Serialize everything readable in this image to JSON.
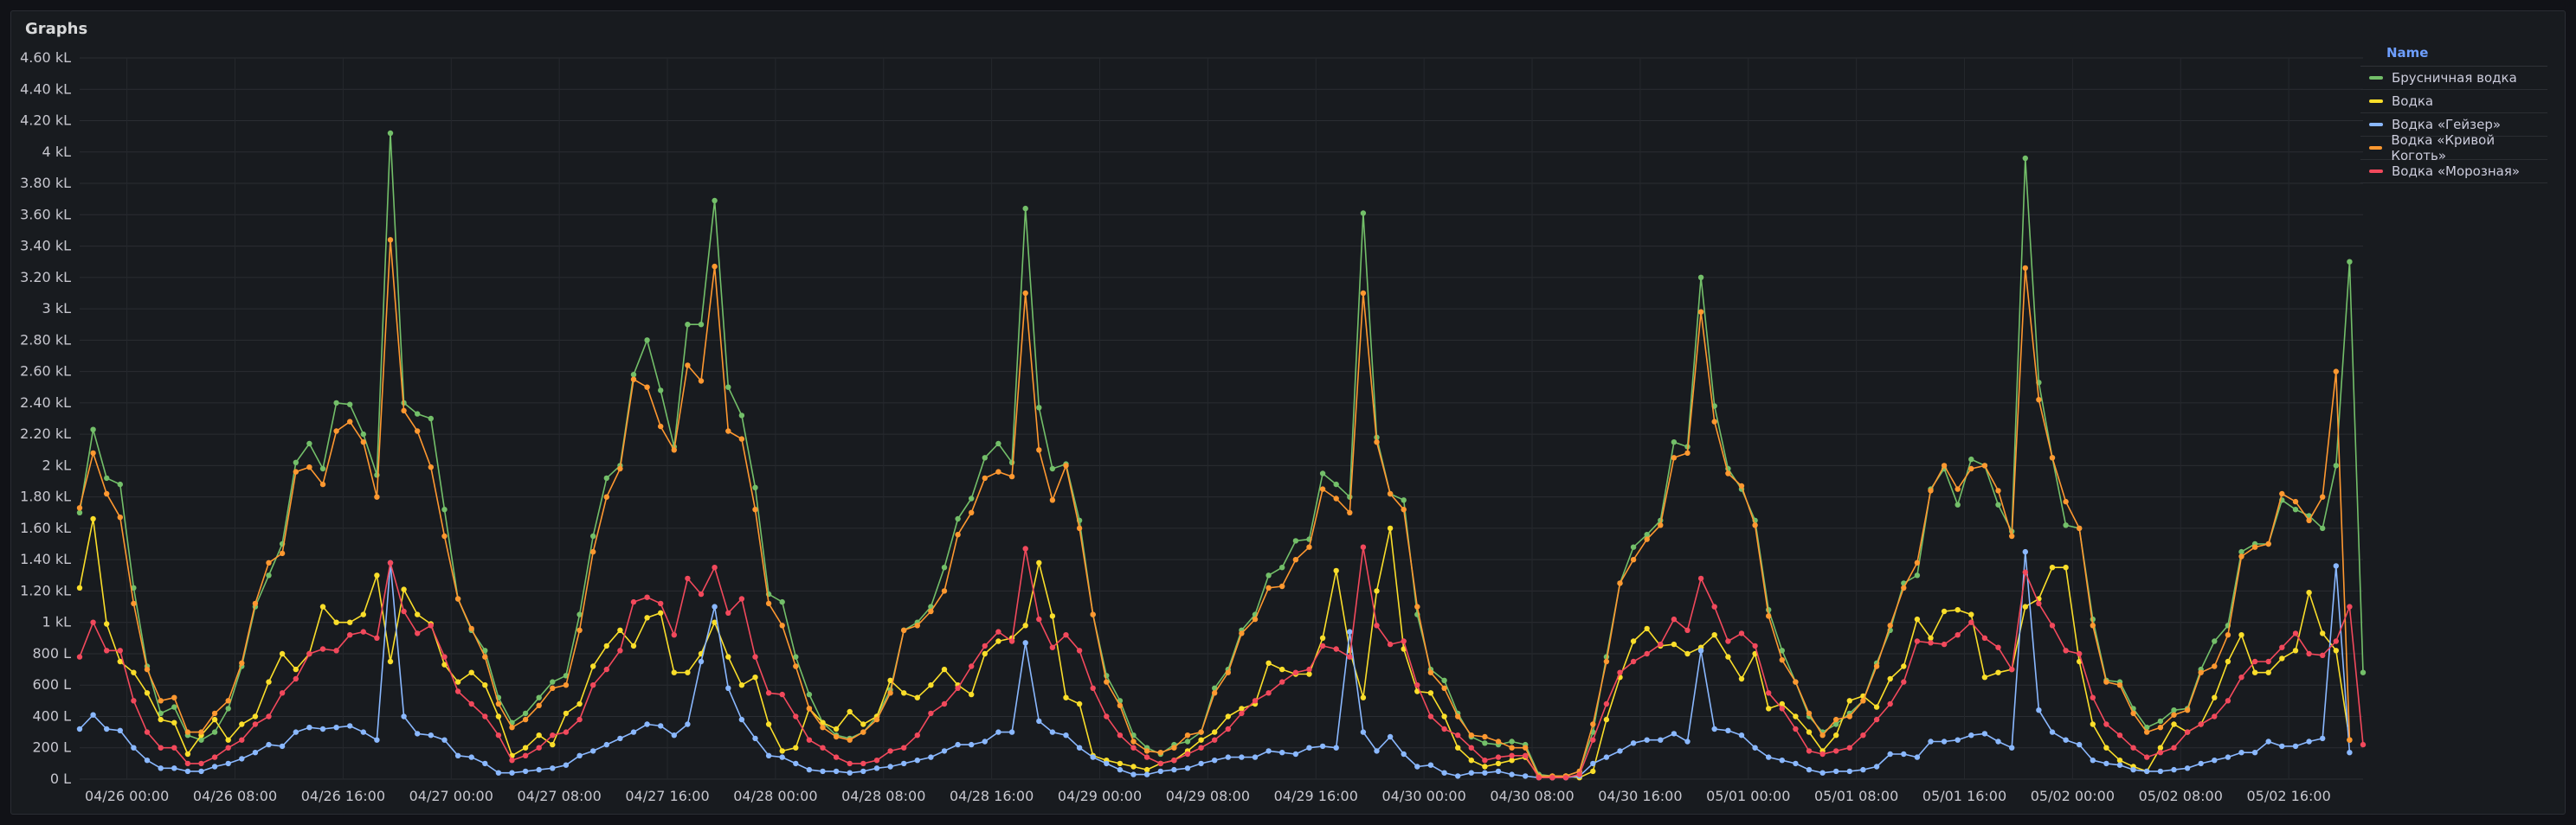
{
  "panel": {
    "title": "Graphs"
  },
  "legend": {
    "header": "Name"
  },
  "colors": {
    "s0": "#73bf69",
    "s1": "#fade2a",
    "s2": "#8ab8ff",
    "s3": "#ff9830",
    "s4": "#f2495c"
  },
  "chart_data": {
    "type": "line",
    "unit": "kL",
    "ylim": [
      0,
      4.6
    ],
    "y_ticks": [
      "0 L",
      "200 L",
      "400 L",
      "600 L",
      "800 L",
      "1 kL",
      "1.20 kL",
      "1.40 kL",
      "1.60 kL",
      "1.80 kL",
      "2 kL",
      "2.20 kL",
      "2.40 kL",
      "2.60 kL",
      "2.80 kL",
      "3 kL",
      "3.20 kL",
      "3.40 kL",
      "3.60 kL",
      "3.80 kL",
      "4 kL",
      "4.20 kL",
      "4.40 kL",
      "4.60 kL"
    ],
    "x_ticks": [
      "04/26 00:00",
      "04/26 08:00",
      "04/26 16:00",
      "04/27 00:00",
      "04/27 08:00",
      "04/27 16:00",
      "04/28 00:00",
      "04/28 08:00",
      "04/28 16:00",
      "04/29 00:00",
      "04/29 08:00",
      "04/29 16:00",
      "04/30 00:00",
      "04/30 08:00",
      "04/30 16:00",
      "05/01 00:00",
      "05/01 08:00",
      "05/01 16:00",
      "05/02 00:00",
      "05/02 08:00",
      "05/02 16:00"
    ],
    "x_start_hours": -3.5,
    "x_step_hours": 1,
    "grid": true,
    "legend_position": "right",
    "series": [
      {
        "name": "Брусничная водка",
        "values": [
          1.7,
          2.23,
          1.92,
          1.88,
          1.22,
          0.72,
          0.42,
          0.46,
          0.28,
          0.25,
          0.3,
          0.45,
          0.72,
          1.1,
          1.3,
          1.5,
          2.02,
          2.14,
          1.98,
          2.4,
          2.39,
          2.2,
          1.94,
          4.12,
          2.4,
          2.33,
          2.3,
          1.72,
          1.15,
          0.95,
          0.82,
          0.52,
          0.36,
          0.42,
          0.52,
          0.62,
          0.66,
          1.05,
          1.55,
          1.92,
          2,
          2.58,
          2.8,
          2.48,
          2.12,
          2.9,
          2.9,
          3.69,
          2.5,
          2.32,
          1.86,
          1.18,
          1.13,
          0.78,
          0.54,
          0.36,
          0.28,
          0.26,
          0.3,
          0.4,
          0.57,
          0.95,
          1,
          1.1,
          1.35,
          1.66,
          1.79,
          2.05,
          2.14,
          2.02,
          3.64,
          2.37,
          1.98,
          2.01,
          1.65,
          1.05,
          0.66,
          0.5,
          0.28,
          0.2,
          0.16,
          0.22,
          0.24,
          0.3,
          0.58,
          0.7,
          0.95,
          1.05,
          1.3,
          1.35,
          1.52,
          1.53,
          1.95,
          1.88,
          1.8,
          3.61,
          2.18,
          1.82,
          1.78,
          1.05,
          0.7,
          0.63,
          0.42,
          0.27,
          0.23,
          0.22,
          0.24,
          0.22,
          0.03,
          0.02,
          0.02,
          0.05,
          0.3,
          0.78,
          1.25,
          1.48,
          1.56,
          1.65,
          2.15,
          2.12,
          3.2,
          2.38,
          1.98,
          1.85,
          1.65,
          1.08,
          0.82,
          0.62,
          0.4,
          0.3,
          0.35,
          0.42,
          0.5,
          0.74,
          0.95,
          1.25,
          1.3,
          1.85,
          1.98,
          1.75,
          2.04,
          2,
          1.75,
          1.58,
          3.96,
          2.53,
          2.05,
          1.62,
          1.6,
          1.02,
          0.63,
          0.62,
          0.45,
          0.33,
          0.37,
          0.44,
          0.45,
          0.7,
          0.88,
          0.98,
          1.45,
          1.5,
          1.5,
          1.78,
          1.72,
          1.68,
          1.6,
          2,
          3.3,
          0.68
        ]
      },
      {
        "name": "Водка",
        "values": [
          1.22,
          1.66,
          0.99,
          0.75,
          0.68,
          0.55,
          0.38,
          0.36,
          0.16,
          0.28,
          0.38,
          0.25,
          0.35,
          0.4,
          0.62,
          0.8,
          0.7,
          0.8,
          1.1,
          1,
          1,
          1.05,
          1.3,
          0.75,
          1.21,
          1.05,
          0.99,
          0.73,
          0.62,
          0.68,
          0.6,
          0.4,
          0.15,
          0.2,
          0.28,
          0.22,
          0.42,
          0.48,
          0.72,
          0.85,
          0.95,
          0.85,
          1.03,
          1.06,
          0.68,
          0.68,
          0.8,
          1,
          0.78,
          0.6,
          0.65,
          0.35,
          0.18,
          0.2,
          0.45,
          0.36,
          0.32,
          0.43,
          0.35,
          0.4,
          0.63,
          0.55,
          0.52,
          0.6,
          0.7,
          0.6,
          0.54,
          0.8,
          0.88,
          0.9,
          0.98,
          1.38,
          1.04,
          0.52,
          0.48,
          0.15,
          0.12,
          0.1,
          0.08,
          0.06,
          0.1,
          0.12,
          0.18,
          0.25,
          0.3,
          0.4,
          0.45,
          0.48,
          0.74,
          0.7,
          0.67,
          0.67,
          0.9,
          1.33,
          0.82,
          0.52,
          1.2,
          1.6,
          0.83,
          0.56,
          0.55,
          0.4,
          0.2,
          0.12,
          0.08,
          0.1,
          0.12,
          0.14,
          0.02,
          0.01,
          0.02,
          0.01,
          0.05,
          0.38,
          0.65,
          0.88,
          0.96,
          0.85,
          0.86,
          0.8,
          0.84,
          0.92,
          0.78,
          0.64,
          0.8,
          0.45,
          0.48,
          0.4,
          0.3,
          0.18,
          0.28,
          0.5,
          0.53,
          0.46,
          0.64,
          0.72,
          1.02,
          0.9,
          1.07,
          1.08,
          1.05,
          0.65,
          0.68,
          0.7,
          1.1,
          1.15,
          1.35,
          1.35,
          0.75,
          0.35,
          0.2,
          0.12,
          0.08,
          0.05,
          0.2,
          0.35,
          0.3,
          0.35,
          0.52,
          0.75,
          0.92,
          0.68,
          0.68,
          0.77,
          0.82,
          1.19,
          0.93,
          0.82,
          0.25
        ]
      },
      {
        "name": "Водка «Гейзер»",
        "values": [
          0.32,
          0.41,
          0.32,
          0.31,
          0.2,
          0.12,
          0.07,
          0.07,
          0.05,
          0.05,
          0.08,
          0.1,
          0.13,
          0.17,
          0.22,
          0.21,
          0.3,
          0.33,
          0.32,
          0.33,
          0.34,
          0.3,
          0.25,
          1.38,
          0.4,
          0.29,
          0.28,
          0.25,
          0.15,
          0.14,
          0.1,
          0.04,
          0.04,
          0.05,
          0.06,
          0.07,
          0.09,
          0.15,
          0.18,
          0.22,
          0.26,
          0.3,
          0.35,
          0.34,
          0.28,
          0.35,
          0.75,
          1.1,
          0.58,
          0.38,
          0.26,
          0.15,
          0.14,
          0.1,
          0.06,
          0.05,
          0.05,
          0.04,
          0.05,
          0.07,
          0.08,
          0.1,
          0.12,
          0.14,
          0.18,
          0.22,
          0.22,
          0.24,
          0.3,
          0.3,
          0.87,
          0.37,
          0.3,
          0.28,
          0.2,
          0.14,
          0.1,
          0.06,
          0.03,
          0.03,
          0.05,
          0.06,
          0.07,
          0.1,
          0.12,
          0.14,
          0.14,
          0.14,
          0.18,
          0.17,
          0.16,
          0.2,
          0.21,
          0.2,
          0.94,
          0.3,
          0.18,
          0.27,
          0.16,
          0.08,
          0.09,
          0.04,
          0.02,
          0.04,
          0.04,
          0.05,
          0.03,
          0.02,
          0.01,
          0.01,
          0.01,
          0.02,
          0.1,
          0.14,
          0.18,
          0.23,
          0.25,
          0.25,
          0.29,
          0.24,
          0.82,
          0.32,
          0.31,
          0.28,
          0.2,
          0.14,
          0.12,
          0.1,
          0.06,
          0.04,
          0.05,
          0.05,
          0.06,
          0.08,
          0.16,
          0.16,
          0.14,
          0.24,
          0.24,
          0.25,
          0.28,
          0.29,
          0.24,
          0.2,
          1.45,
          0.44,
          0.3,
          0.25,
          0.22,
          0.12,
          0.1,
          0.09,
          0.06,
          0.05,
          0.05,
          0.06,
          0.07,
          0.1,
          0.12,
          0.14,
          0.17,
          0.17,
          0.24,
          0.21,
          0.21,
          0.24,
          0.26,
          1.36,
          0.17
        ]
      },
      {
        "name": "Водка «Кривой Коготь»",
        "values": [
          1.73,
          2.08,
          1.82,
          1.67,
          1.12,
          0.7,
          0.5,
          0.52,
          0.3,
          0.3,
          0.42,
          0.5,
          0.74,
          1.12,
          1.38,
          1.44,
          1.96,
          1.99,
          1.88,
          2.22,
          2.28,
          2.15,
          1.8,
          3.44,
          2.35,
          2.22,
          1.99,
          1.55,
          1.15,
          0.96,
          0.78,
          0.48,
          0.33,
          0.38,
          0.47,
          0.58,
          0.6,
          0.95,
          1.45,
          1.8,
          1.98,
          2.55,
          2.5,
          2.25,
          2.1,
          2.64,
          2.54,
          3.27,
          2.22,
          2.17,
          1.72,
          1.12,
          0.98,
          0.72,
          0.45,
          0.33,
          0.27,
          0.25,
          0.3,
          0.38,
          0.55,
          0.95,
          0.98,
          1.07,
          1.2,
          1.56,
          1.7,
          1.92,
          1.96,
          1.93,
          3.1,
          2.1,
          1.78,
          2,
          1.6,
          1.05,
          0.62,
          0.47,
          0.24,
          0.18,
          0.17,
          0.2,
          0.28,
          0.3,
          0.55,
          0.68,
          0.93,
          1.02,
          1.22,
          1.23,
          1.4,
          1.48,
          1.85,
          1.79,
          1.7,
          3.1,
          2.15,
          1.82,
          1.72,
          1.1,
          0.68,
          0.58,
          0.4,
          0.28,
          0.27,
          0.24,
          0.2,
          0.2,
          0.02,
          0.02,
          0.02,
          0.05,
          0.35,
          0.75,
          1.25,
          1.4,
          1.53,
          1.62,
          2.05,
          2.08,
          2.98,
          2.28,
          1.95,
          1.87,
          1.62,
          1.04,
          0.76,
          0.62,
          0.42,
          0.28,
          0.38,
          0.4,
          0.5,
          0.72,
          0.98,
          1.22,
          1.38,
          1.84,
          2.0,
          1.85,
          1.98,
          2.0,
          1.84,
          1.55,
          3.26,
          2.42,
          2.05,
          1.77,
          1.6,
          0.98,
          0.62,
          0.6,
          0.42,
          0.3,
          0.33,
          0.41,
          0.44,
          0.68,
          0.72,
          0.92,
          1.42,
          1.48,
          1.5,
          1.82,
          1.77,
          1.65,
          1.8,
          2.6,
          0.25
        ]
      },
      {
        "name": "Водка «Морозная»",
        "values": [
          0.78,
          1,
          0.82,
          0.82,
          0.5,
          0.3,
          0.2,
          0.2,
          0.1,
          0.1,
          0.14,
          0.2,
          0.25,
          0.35,
          0.4,
          0.55,
          0.64,
          0.8,
          0.83,
          0.82,
          0.92,
          0.94,
          0.9,
          1.38,
          1.07,
          0.93,
          0.98,
          0.78,
          0.56,
          0.48,
          0.4,
          0.28,
          0.12,
          0.15,
          0.2,
          0.28,
          0.3,
          0.38,
          0.6,
          0.7,
          0.82,
          1.13,
          1.16,
          1.12,
          0.92,
          1.28,
          1.18,
          1.35,
          1.06,
          1.15,
          0.78,
          0.55,
          0.54,
          0.4,
          0.25,
          0.2,
          0.14,
          0.1,
          0.1,
          0.12,
          0.18,
          0.2,
          0.28,
          0.42,
          0.48,
          0.58,
          0.72,
          0.85,
          0.94,
          0.88,
          1.47,
          1.02,
          0.84,
          0.92,
          0.82,
          0.58,
          0.4,
          0.28,
          0.2,
          0.14,
          0.1,
          0.12,
          0.16,
          0.2,
          0.25,
          0.32,
          0.42,
          0.5,
          0.55,
          0.62,
          0.68,
          0.7,
          0.85,
          0.83,
          0.78,
          1.48,
          0.98,
          0.86,
          0.88,
          0.6,
          0.4,
          0.32,
          0.28,
          0.2,
          0.12,
          0.14,
          0.15,
          0.15,
          0.01,
          0.01,
          0.01,
          0.03,
          0.25,
          0.48,
          0.68,
          0.75,
          0.8,
          0.86,
          1.02,
          0.95,
          1.28,
          1.1,
          0.88,
          0.93,
          0.85,
          0.55,
          0.45,
          0.32,
          0.18,
          0.16,
          0.18,
          0.2,
          0.28,
          0.38,
          0.48,
          0.62,
          0.88,
          0.87,
          0.86,
          0.92,
          1.0,
          0.9,
          0.84,
          0.7,
          1.32,
          1.12,
          0.98,
          0.82,
          0.8,
          0.52,
          0.35,
          0.28,
          0.2,
          0.14,
          0.17,
          0.2,
          0.3,
          0.35,
          0.4,
          0.5,
          0.65,
          0.75,
          0.75,
          0.84,
          0.93,
          0.8,
          0.79,
          0.88,
          1.1,
          0.22
        ]
      }
    ]
  }
}
